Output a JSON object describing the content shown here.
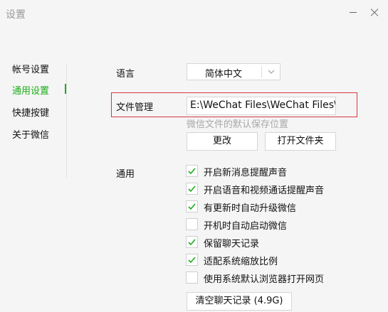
{
  "window": {
    "title": "设置"
  },
  "sidebar": {
    "items": [
      {
        "label": "帐号设置",
        "active": false
      },
      {
        "label": "通用设置",
        "active": true
      },
      {
        "label": "快捷按键",
        "active": false
      },
      {
        "label": "关于微信",
        "active": false
      }
    ]
  },
  "language": {
    "label": "语言",
    "selected": "简体中文"
  },
  "file_management": {
    "label": "文件管理",
    "path": "E:\\WeChat Files\\WeChat Files\\",
    "hint": "微信文件的默认保存位置",
    "change_label": "更改",
    "open_folder_label": "打开文件夹"
  },
  "general": {
    "label": "通用",
    "options": [
      {
        "label": "开启新消息提醒声音",
        "checked": true
      },
      {
        "label": "开启语音和视频通话提醒声音",
        "checked": true
      },
      {
        "label": "有更新时自动升级微信",
        "checked": true
      },
      {
        "label": "开机时自动启动微信",
        "checked": false
      },
      {
        "label": "保留聊天记录",
        "checked": true
      },
      {
        "label": "适配系统缩放比例",
        "checked": true
      },
      {
        "label": "使用系统默认浏览器打开网页",
        "checked": false
      }
    ],
    "clear_history_label": "清空聊天记录 (4.9G)"
  },
  "colors": {
    "accent": "#1aad19",
    "highlight": "#d9363e"
  }
}
